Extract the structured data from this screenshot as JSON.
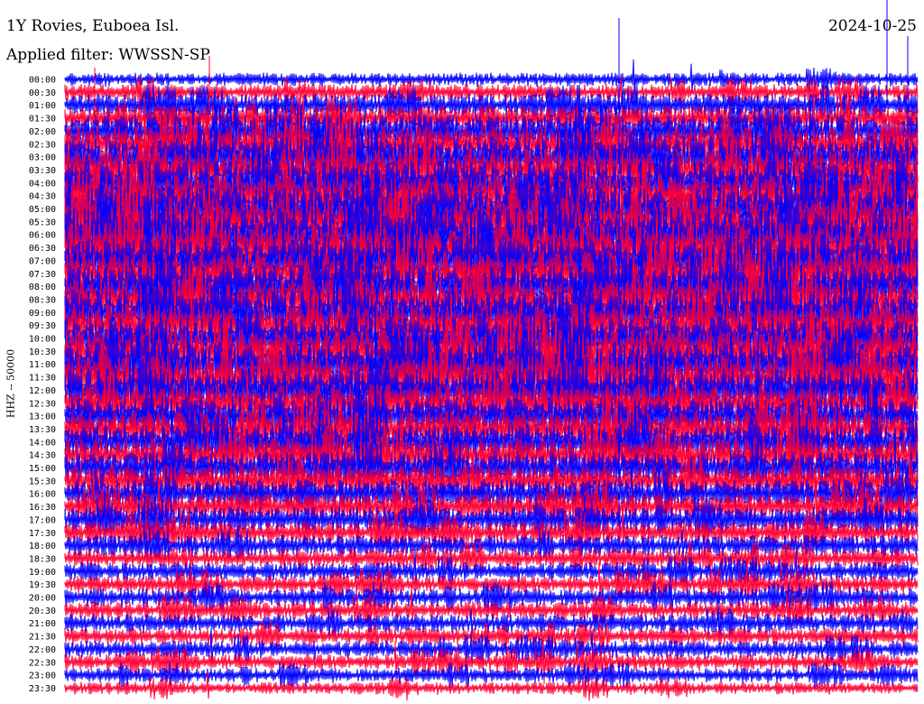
{
  "header": {
    "station": "1Y Rovies, Euboea Isl.",
    "date": "2024-10-25",
    "filter": "Applied filter: WWSSN-SP"
  },
  "chart_data": {
    "type": "line",
    "ylabel": "HHZ -- 50000",
    "row_labels": [
      "00:00",
      "00:30",
      "01:00",
      "01:30",
      "02:00",
      "02:30",
      "03:00",
      "03:30",
      "04:00",
      "04:30",
      "05:00",
      "05:30",
      "06:00",
      "06:30",
      "07:00",
      "07:30",
      "08:00",
      "08:30",
      "09:00",
      "09:30",
      "10:00",
      "10:30",
      "11:00",
      "11:30",
      "12:00",
      "12:30",
      "13:00",
      "13:30",
      "14:00",
      "14:30",
      "15:00",
      "15:30",
      "16:00",
      "16:30",
      "17:00",
      "17:30",
      "18:00",
      "18:30",
      "19:00",
      "19:30",
      "20:00",
      "20:30",
      "21:00",
      "21:30",
      "22:00",
      "22:30",
      "23:00",
      "23:30"
    ],
    "row_colors": [
      "#0000ff",
      "#ff0033"
    ],
    "relative_noise_level": [
      0.1,
      0.15,
      0.25,
      0.3,
      0.42,
      0.5,
      0.55,
      0.58,
      0.6,
      0.62,
      0.65,
      0.7,
      0.75,
      0.7,
      0.68,
      0.62,
      0.6,
      0.58,
      0.62,
      0.6,
      0.58,
      0.62,
      0.62,
      0.6,
      0.58,
      0.5,
      0.48,
      0.46,
      0.45,
      0.44,
      0.42,
      0.4,
      0.35,
      0.32,
      0.3,
      0.25,
      0.22,
      0.2,
      0.18,
      0.17,
      0.18,
      0.17,
      0.18,
      0.16,
      0.16,
      0.15,
      0.12,
      0.08
    ]
  }
}
